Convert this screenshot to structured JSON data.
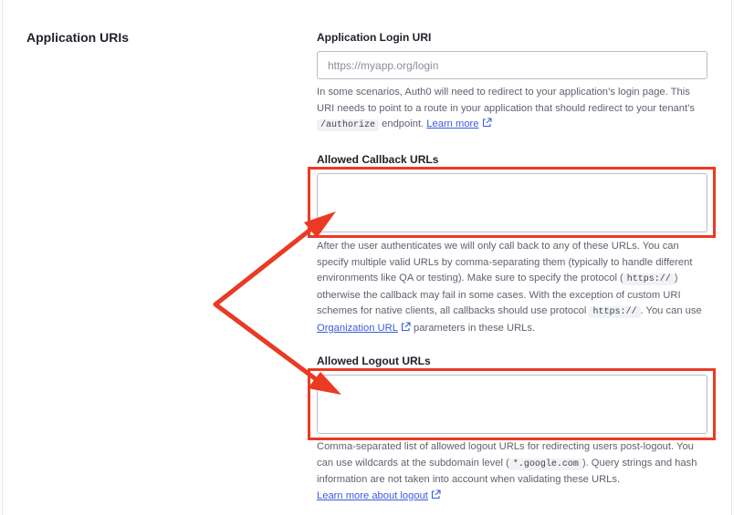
{
  "section": {
    "title": "Application URIs"
  },
  "login_uri": {
    "label": "Application Login URI",
    "placeholder": "https://myapp.org/login",
    "help_before": "In some scenarios, Auth0 will need to redirect to your application’s login page. This URI needs to point to a route in your application that should redirect to your tenant’s",
    "help_code": "/authorize",
    "help_after": "endpoint.",
    "link": "Learn more"
  },
  "callback_urls": {
    "label": "Allowed Callback URLs",
    "value": "",
    "help_1": "After the user authenticates we will only call back to any of these URLs. You can specify multiple valid URLs by comma-separating them (typically to handle different environments like QA or testing). Make sure to specify the protocol (",
    "help_code_1": "https://",
    "help_2": ") otherwise the callback may fail in some cases. With the exception of custom URI schemes for native clients, all callbacks should use protocol",
    "help_code_2": "https://",
    "help_3": ". You can use",
    "link": "Organization URL",
    "help_4": "parameters in these URLs."
  },
  "logout_urls": {
    "label": "Allowed Logout URLs",
    "value": "",
    "help_1": "Comma-separated list of allowed logout URLs for redirecting users post-logout. You can use wildcards at the subdomain level (",
    "help_code": "*.google.com",
    "help_2": "). Query strings and hash information are not taken into account when validating these URLs.",
    "link": "Learn more about logout"
  },
  "annotation": {
    "color": "#ea3a24"
  },
  "icons": {
    "external_link": "external-link-icon"
  }
}
